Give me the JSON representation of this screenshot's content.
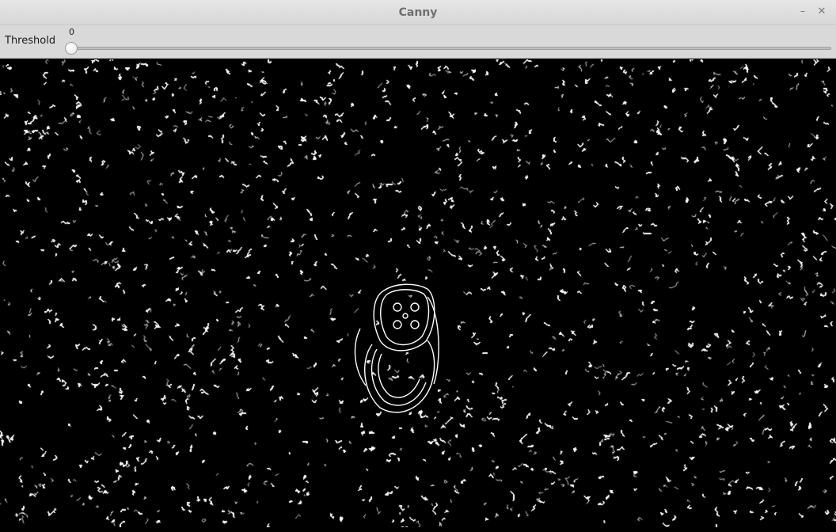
{
  "window": {
    "title": "Canny",
    "minimize_icon": "minimize-icon",
    "close_icon": "close-icon"
  },
  "toolbar": {
    "threshold_label": "Threshold",
    "threshold_value": "0",
    "threshold_fraction": 0
  },
  "image": {
    "description_icon": "edge-map-image",
    "edge_color": "#ffffff",
    "background_color": "#000000"
  }
}
